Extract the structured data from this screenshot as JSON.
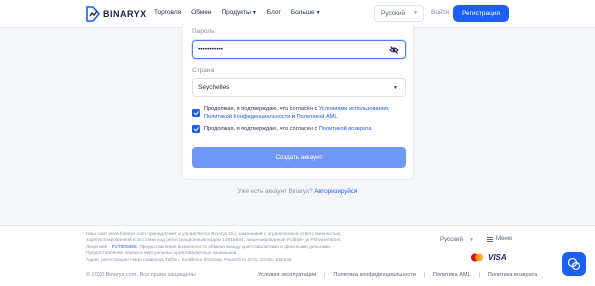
{
  "header": {
    "brand": "BINARYX",
    "nav": [
      {
        "label": "Торговля",
        "caret": false
      },
      {
        "label": "Обмен",
        "caret": false
      },
      {
        "label": "Продукты",
        "caret": true
      },
      {
        "label": "Блог",
        "caret": false
      },
      {
        "label": "Больше",
        "caret": true
      }
    ],
    "language": "Русский",
    "login_label": "Войти",
    "register_label": "Регистрация"
  },
  "form": {
    "password_label": "Пароль",
    "password_value": "•••••••••••",
    "country_label": "Страна",
    "country_value": "Seychelles",
    "consent1": {
      "prefix": "Продолжая, я подтверждаю, что согласен с ",
      "link1": "Условиями использования,",
      "link2": "Политикой Конфиденциальности",
      "and": " и ",
      "link3": "Политикой AML"
    },
    "consent2": {
      "prefix": "Продолжая, я подтверждаю, что согласен с ",
      "link": "Политикой возврата"
    },
    "submit_label": "Создать аккаунт",
    "have_account": "Уже есть аккаунт Binaryx?",
    "login_link": "Авторизируйся"
  },
  "footer": {
    "legal_1": "Наш сайт www.binaryx.com принадлежит и управляется Binaryx OÜ, компанией с ограниченной ответственностью,",
    "legal_2": "зарегистрированной в Эстонии под регистрационным кодом 14815844, лицензированной Politsei- ja Piirivalveamet.",
    "legal_3_prefix": "Лицензия - ",
    "legal_3_link": "FVT000465",
    "legal_3_suffix": ". Предоставление возможности обмена между криптовалютами и фиатными деньгами.",
    "legal_4": "Предоставление сервиса виртуальных криптовалютных кошельков.",
    "legal_5": "Адрес регистрации Harju maakond, Tallinn, Kesklinna linnaosa, Pooordi tn 3/75, 10156, Estonia.",
    "language": "Русский",
    "menu_label": "Меню",
    "visa": "VISA",
    "copyright": "© 2020 Binaryx.com. Все права защищены",
    "links": [
      "Условия эксплуатации",
      "Политика конфиденциальности",
      "Политика AML",
      "Политика возврата"
    ]
  },
  "colors": {
    "primary": "#1d5ef5",
    "submit_disabled": "#6f98f6",
    "background": "#f4f6fa"
  }
}
